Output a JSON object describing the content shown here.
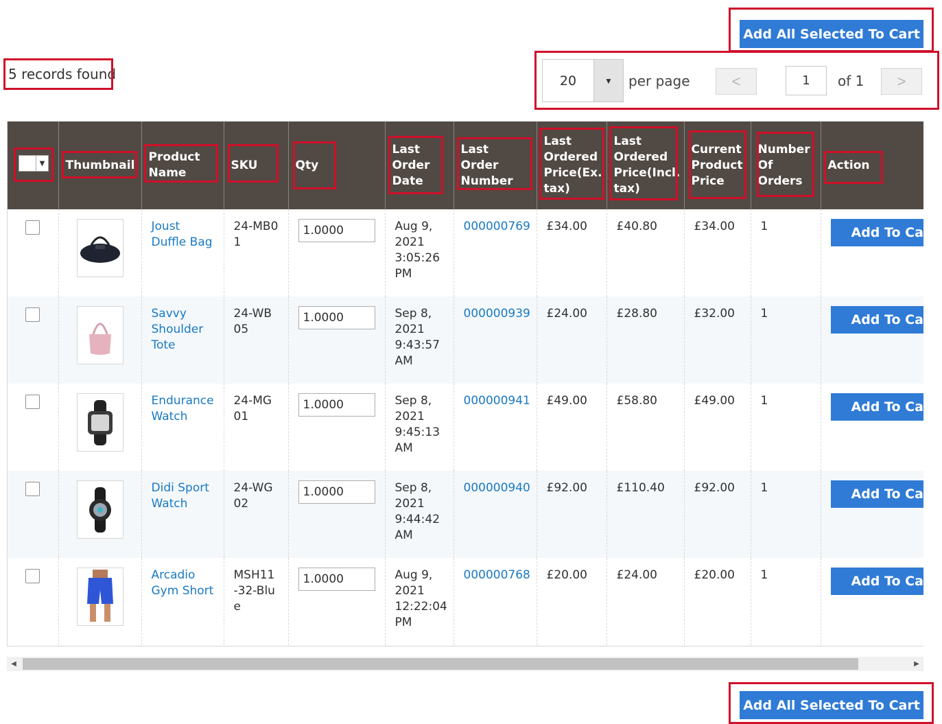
{
  "top_button": {
    "label": "Add All Selected To Cart"
  },
  "bottom_button": {
    "label": "Add All Selected To Cart"
  },
  "records": {
    "text": "5 records found"
  },
  "pager": {
    "per_page_value": "20",
    "per_page_label": "per page",
    "prev": "<",
    "next": ">",
    "current_page": "1",
    "of_label": "of 1"
  },
  "columns": {
    "thumbnail": "Thumbnail",
    "product_name": "Product Name",
    "sku": "SKU",
    "qty": "Qty",
    "last_order_date": "Last Order Date",
    "last_order_number": "Last Order Number",
    "last_price_ex": "Last Ordered Price(Ex. tax)",
    "last_price_incl": "Last Ordered Price(Incl. tax)",
    "current_price": "Current Product Price",
    "num_orders": "Number Of Orders",
    "action": "Action"
  },
  "rows": [
    {
      "name": "Joust Duffle Bag",
      "sku": "24-MB01",
      "qty": "1.0000",
      "date": "Aug 9, 2021 3:05:26 PM",
      "order": "000000769",
      "price_ex": "£34.00",
      "price_incl": "£40.80",
      "current": "£34.00",
      "orders": "1",
      "action": "Add To Cart",
      "thumb": "duffle-bag-image"
    },
    {
      "name": "Savvy Shoulder Tote",
      "sku": "24-WB05",
      "qty": "1.0000",
      "date": "Sep 8, 2021 9:43:57 AM",
      "order": "000000939",
      "price_ex": "£24.00",
      "price_incl": "£28.80",
      "current": "£32.00",
      "orders": "1",
      "action": "Add To Cart",
      "thumb": "shoulder-tote-image"
    },
    {
      "name": "Endurance Watch",
      "sku": "24-MG01",
      "qty": "1.0000",
      "date": "Sep 8, 2021 9:45:13 AM",
      "order": "000000941",
      "price_ex": "£49.00",
      "price_incl": "£58.80",
      "current": "£49.00",
      "orders": "1",
      "action": "Add To Cart",
      "thumb": "endurance-watch-image"
    },
    {
      "name": "Didi Sport Watch",
      "sku": "24-WG02",
      "qty": "1.0000",
      "date": "Sep 8, 2021 9:44:42 AM",
      "order": "000000940",
      "price_ex": "£92.00",
      "price_incl": "£110.40",
      "current": "£92.00",
      "orders": "1",
      "action": "Add To Cart",
      "thumb": "sport-watch-image"
    },
    {
      "name": "Arcadio Gym Short",
      "sku": "MSH11-32-Blue",
      "qty": "1.0000",
      "date": "Aug 9, 2021 12:22:04 PM",
      "order": "000000768",
      "price_ex": "£20.00",
      "price_incl": "£24.00",
      "current": "£20.00",
      "orders": "1",
      "action": "Add To Cart",
      "thumb": "gym-short-image"
    }
  ],
  "colors": {
    "header_bg": "#514943",
    "button_bg": "#2f7bd6",
    "link": "#1979c3",
    "highlight": "#d0102a"
  }
}
